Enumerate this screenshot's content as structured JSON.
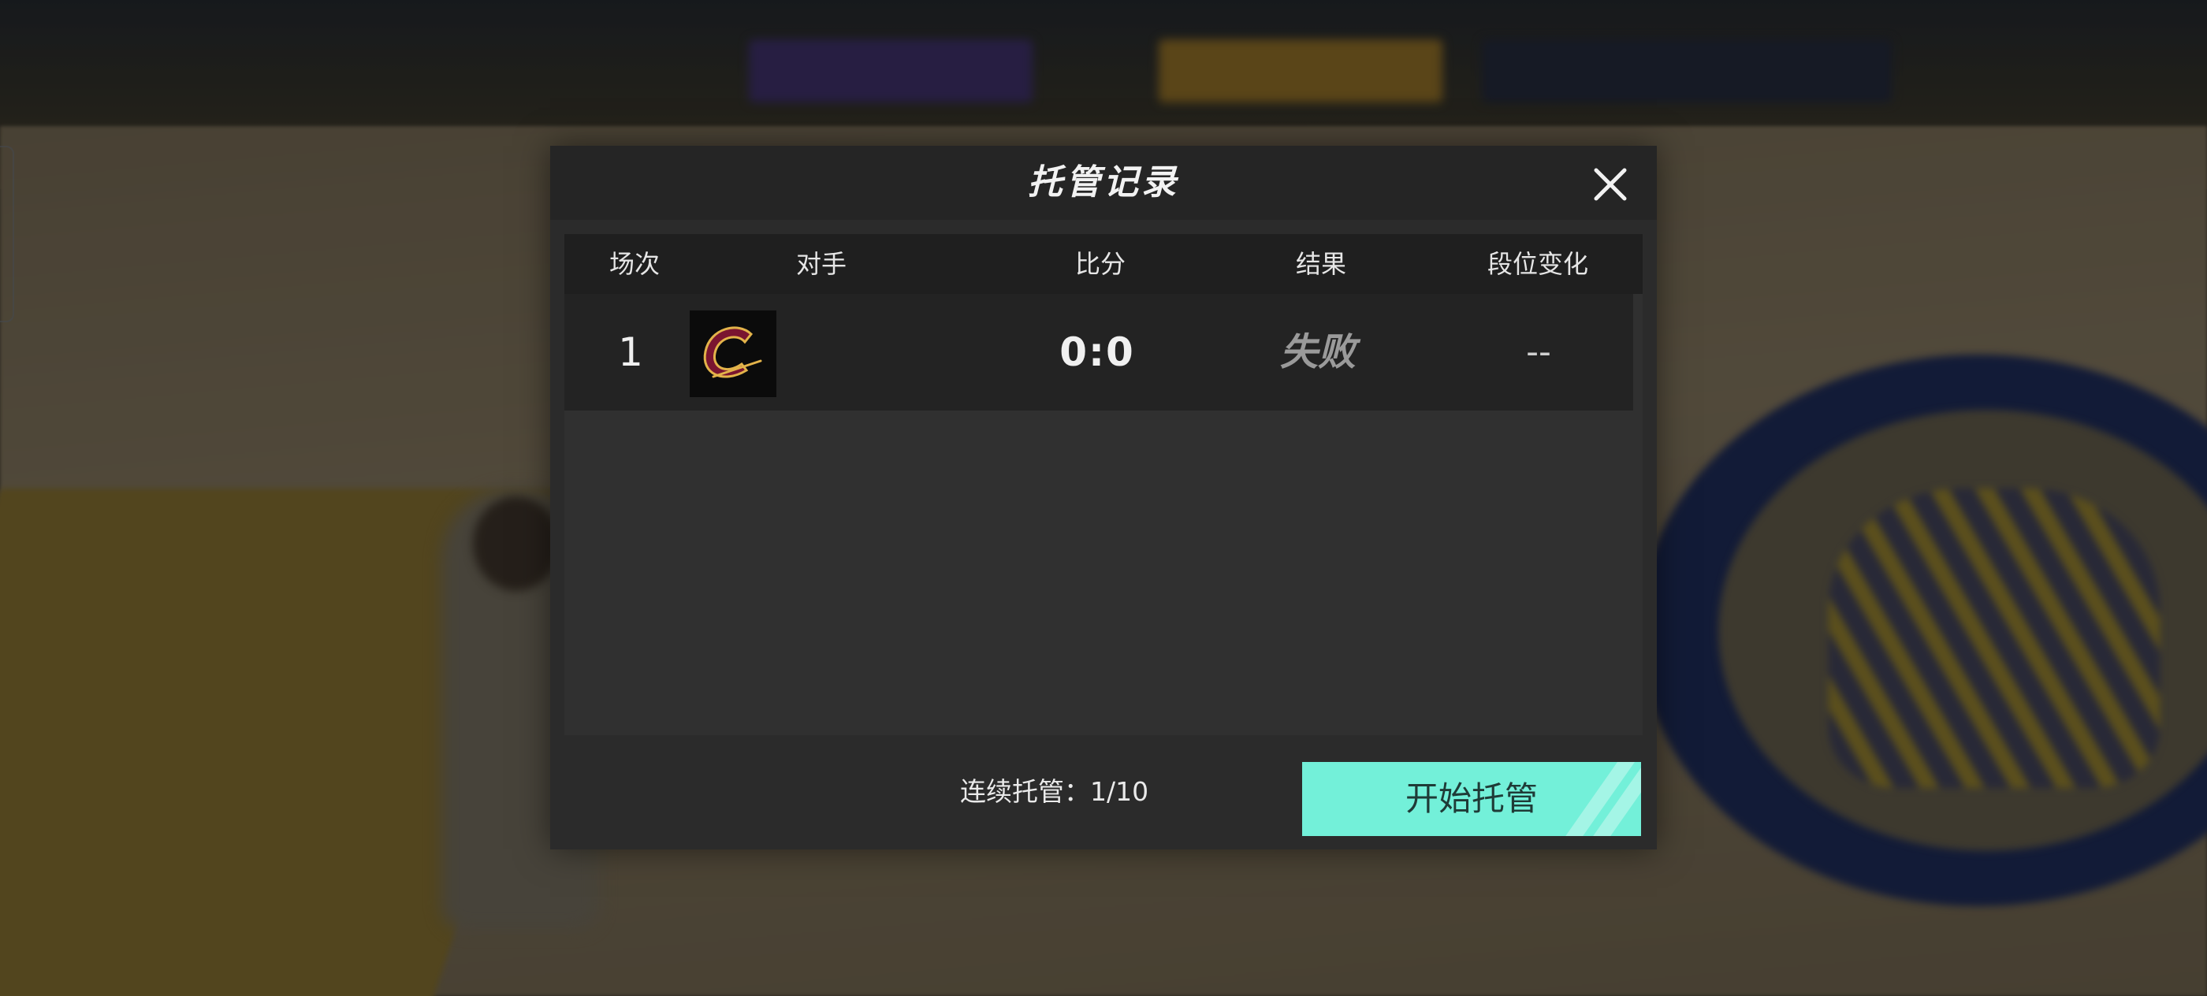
{
  "dialog": {
    "title": "托管记录",
    "close_icon": "close-icon"
  },
  "table": {
    "columns": [
      "场次",
      "对手",
      "比分",
      "结果",
      "段位变化"
    ],
    "rows": [
      {
        "index": "1",
        "opponent_icon": "cavaliers-team-logo",
        "score": "0:0",
        "result": "失败",
        "rank_change": "--"
      }
    ]
  },
  "footer": {
    "status_label": "连续托管：",
    "status_value": "1/10",
    "start_button_label": "开始托管"
  },
  "colors": {
    "accent": "#73f0d9",
    "dialog_bg": "#2b2b2b",
    "header_bg": "#252525",
    "table_head_bg": "#1f1f1f",
    "row_bg": "#232323",
    "result_text": "#9a9a9a"
  }
}
